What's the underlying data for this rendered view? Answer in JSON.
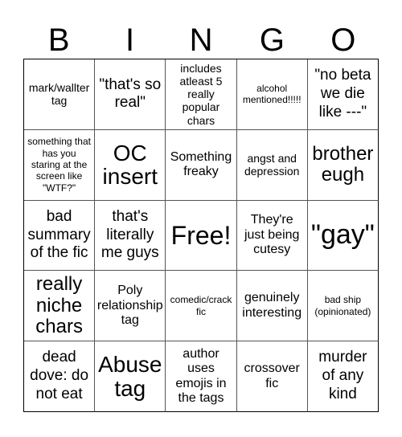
{
  "header": {
    "letters": [
      "B",
      "I",
      "N",
      "G",
      "O"
    ]
  },
  "cells": [
    "mark/wallter tag",
    "\"that's so real\"",
    "includes atleast 5 really popular chars",
    "alcohol mentioned!!!!!",
    "\"no beta we die like ---\"",
    "something that has you staring at the screen like \"WTF?\"",
    "OC insert",
    "Something freaky",
    "angst and depression",
    "brother eugh",
    "bad summary of the fic",
    "that's literally me guys",
    "Free!",
    "They're just being cutesy",
    "\"gay\"",
    "really niche chars",
    "Poly relationship tag",
    "comedic/crack fic",
    "genuinely interesting",
    "bad ship (opinionated)",
    "dead dove: do not eat",
    "Abuse tag",
    "author uses emojis in the tags",
    "crossover fic",
    "murder of any kind"
  ]
}
